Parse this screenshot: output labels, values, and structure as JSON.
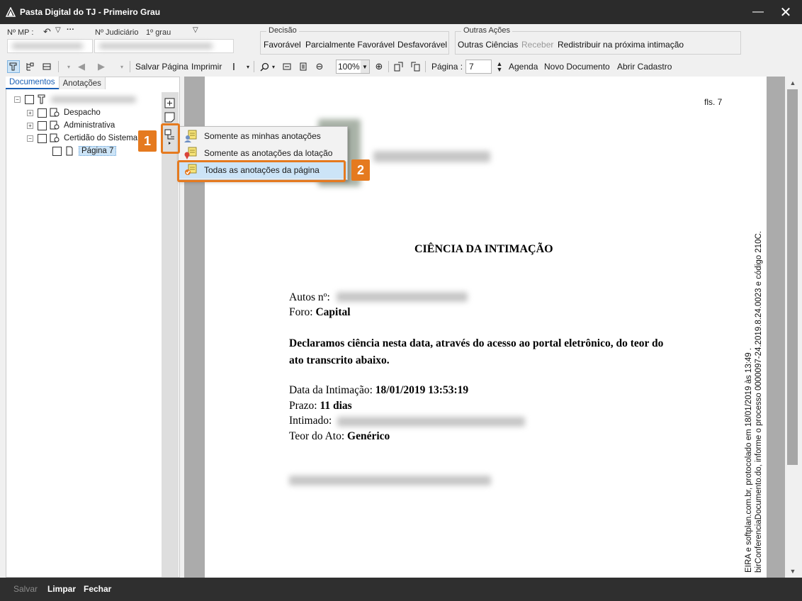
{
  "window": {
    "title": "Pasta Digital do TJ - Primeiro Grau",
    "minimize_label": "—",
    "close_label": "✕"
  },
  "fields": {
    "mp_label": "Nº MP :",
    "judiciario_label": "Nº Judiciário",
    "grau_label": "1º grau"
  },
  "decisao": {
    "title": "Decisão",
    "buttons": [
      "Favorável",
      "Parcialmente Favorável",
      "Desfavorável"
    ]
  },
  "outras_acoes": {
    "title": "Outras Ações",
    "buttons": [
      "Outras Ciências",
      "Receber",
      "Redistribuir na próxima intimação"
    ]
  },
  "toolbar": {
    "salvar_pagina": "Salvar Página",
    "imprimir": "Imprimir",
    "zoom": "100%",
    "pagina_label": "Página :",
    "pagina_value": "7",
    "agenda": "Agenda",
    "novo_documento": "Novo Documento",
    "abrir_cadastro": "Abrir Cadastro"
  },
  "tabs": {
    "documentos": "Documentos",
    "anotacoes": "Anotações"
  },
  "tree": {
    "items": [
      "Despacho",
      "Administrativa",
      "Certidão do Sistema"
    ],
    "page_item": "Página 7"
  },
  "menu": {
    "items": [
      "Somente as minhas anotações",
      "Somente as anotações da lotação",
      "Todas as anotações da página"
    ]
  },
  "callouts": {
    "one": "1",
    "two": "2"
  },
  "document": {
    "fls": "fls. 7",
    "heading": "CIÊNCIA DA INTIMAÇÃO",
    "autos_label": "Autos nº:",
    "foro_label": "Foro:",
    "foro_value": "Capital",
    "declaration_line1": "Declaramos ciência nesta data, através do acesso ao portal eletrônico, do teor do",
    "declaration_line2": "ato transcrito abaixo.",
    "data_label": "Data da Intimação:",
    "data_value": "18/01/2019 13:53:19",
    "prazo_label": "Prazo:",
    "prazo_value": "11 dias",
    "intimado_label": "Intimado:",
    "teor_label": "Teor do Ato:",
    "teor_value": "Genérico",
    "side_line1": "EIRA e softplan.com.br, protocolado em 18/01/2019 às 13:49 .",
    "side_line2": "birConferenciaDocumento.do, informe o processo 0000097-24.2019.8.24.0023 e código 210C."
  },
  "statusbar": {
    "salvar": "Salvar",
    "limpar": "Limpar",
    "fechar": "Fechar"
  },
  "colors": {
    "accent": "#e57a1f",
    "selection": "#cce4f7",
    "titlebar": "#2b2b2b"
  }
}
